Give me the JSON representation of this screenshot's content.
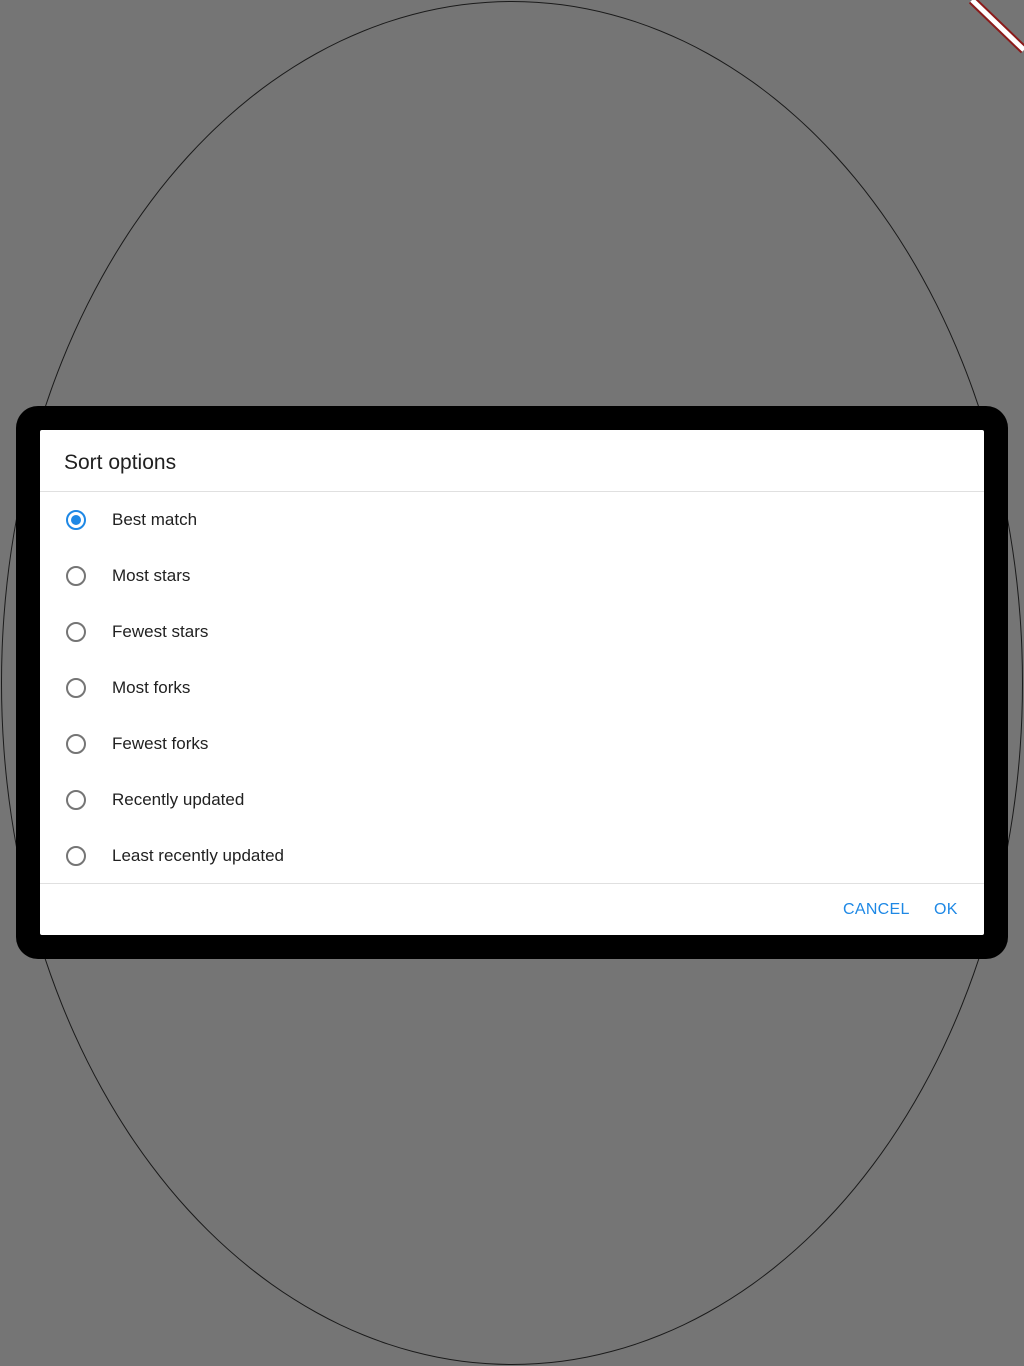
{
  "dialog": {
    "title": "Sort options",
    "options": [
      {
        "label": "Best match",
        "selected": true
      },
      {
        "label": "Most stars",
        "selected": false
      },
      {
        "label": "Fewest stars",
        "selected": false
      },
      {
        "label": "Most forks",
        "selected": false
      },
      {
        "label": "Fewest forks",
        "selected": false
      },
      {
        "label": "Recently updated",
        "selected": false
      },
      {
        "label": "Least recently updated",
        "selected": false
      }
    ],
    "buttons": {
      "cancel_label": "CANCEL",
      "ok_label": "OK"
    }
  },
  "colors": {
    "accent": "#1e88e5",
    "scrim": "#757575",
    "stripe": "#8b1a1a"
  }
}
